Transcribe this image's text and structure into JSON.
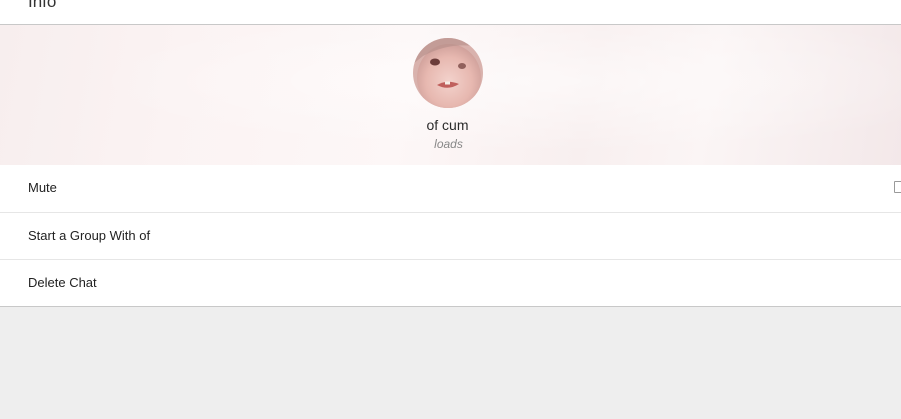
{
  "header": {
    "title": "Info"
  },
  "profile": {
    "name": "of cum",
    "status": "loads"
  },
  "menu": {
    "items": [
      {
        "label": "Mute",
        "checked": false
      },
      {
        "label": "Start a Group With of"
      },
      {
        "label": "Delete Chat"
      }
    ]
  }
}
